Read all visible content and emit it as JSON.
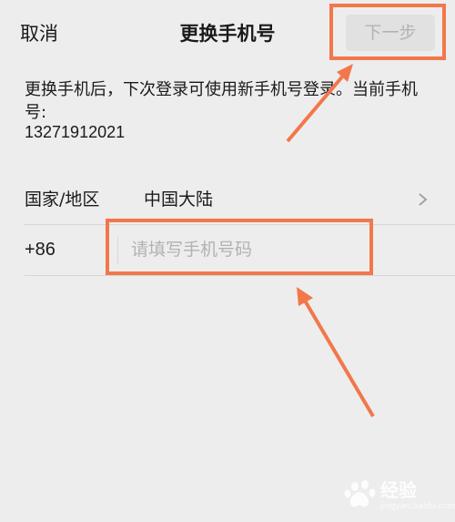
{
  "nav": {
    "cancel_label": "取消",
    "title": "更换手机号",
    "next_label": "下一步"
  },
  "description": "更换手机后，下次登录可使用新手机号登录。当前手机号:",
  "current_phone": "13271912021",
  "country_row": {
    "label": "国家/地区",
    "value": "中国大陆",
    "icon": "chevron-right-icon"
  },
  "phone_row": {
    "country_code": "+86",
    "placeholder": "请填写手机号码",
    "value": ""
  },
  "watermark": {
    "brand": "经验",
    "site": "jingyan.baidu.com"
  },
  "colors": {
    "background": "#ededed",
    "highlight": "#f2774b",
    "button_disabled_bg": "#e1e1e1",
    "button_disabled_text": "#b3b3b3"
  }
}
